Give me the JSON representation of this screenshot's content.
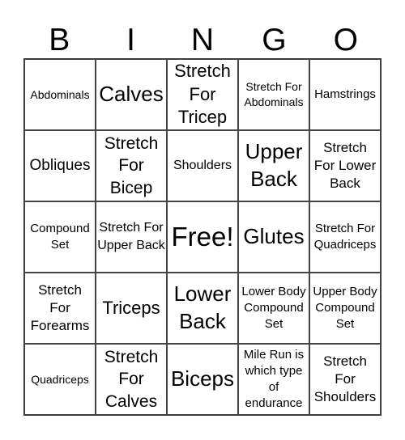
{
  "header": [
    "B",
    "I",
    "N",
    "G",
    "O"
  ],
  "cells": [
    "Abdominals",
    "Calves",
    "Stretch For Tricep",
    "Stretch For Abdominals",
    "Hamstrings",
    "Obliques",
    "Stretch For Bicep",
    "Shoulders",
    "Upper Back",
    "Stretch For Lower Back",
    "Compound Set",
    "Stretch For Upper Back",
    "Free!",
    "Glutes",
    "Stretch For Quadriceps",
    "Stretch For Forearms",
    "Triceps",
    "Lower Back",
    "Lower Body Compound Set",
    "Upper Body Compound Set",
    "Quadriceps",
    "Stretch For Calves",
    "Biceps",
    "Mile Run is which type of endurance",
    "Stretch For Shoulders"
  ]
}
